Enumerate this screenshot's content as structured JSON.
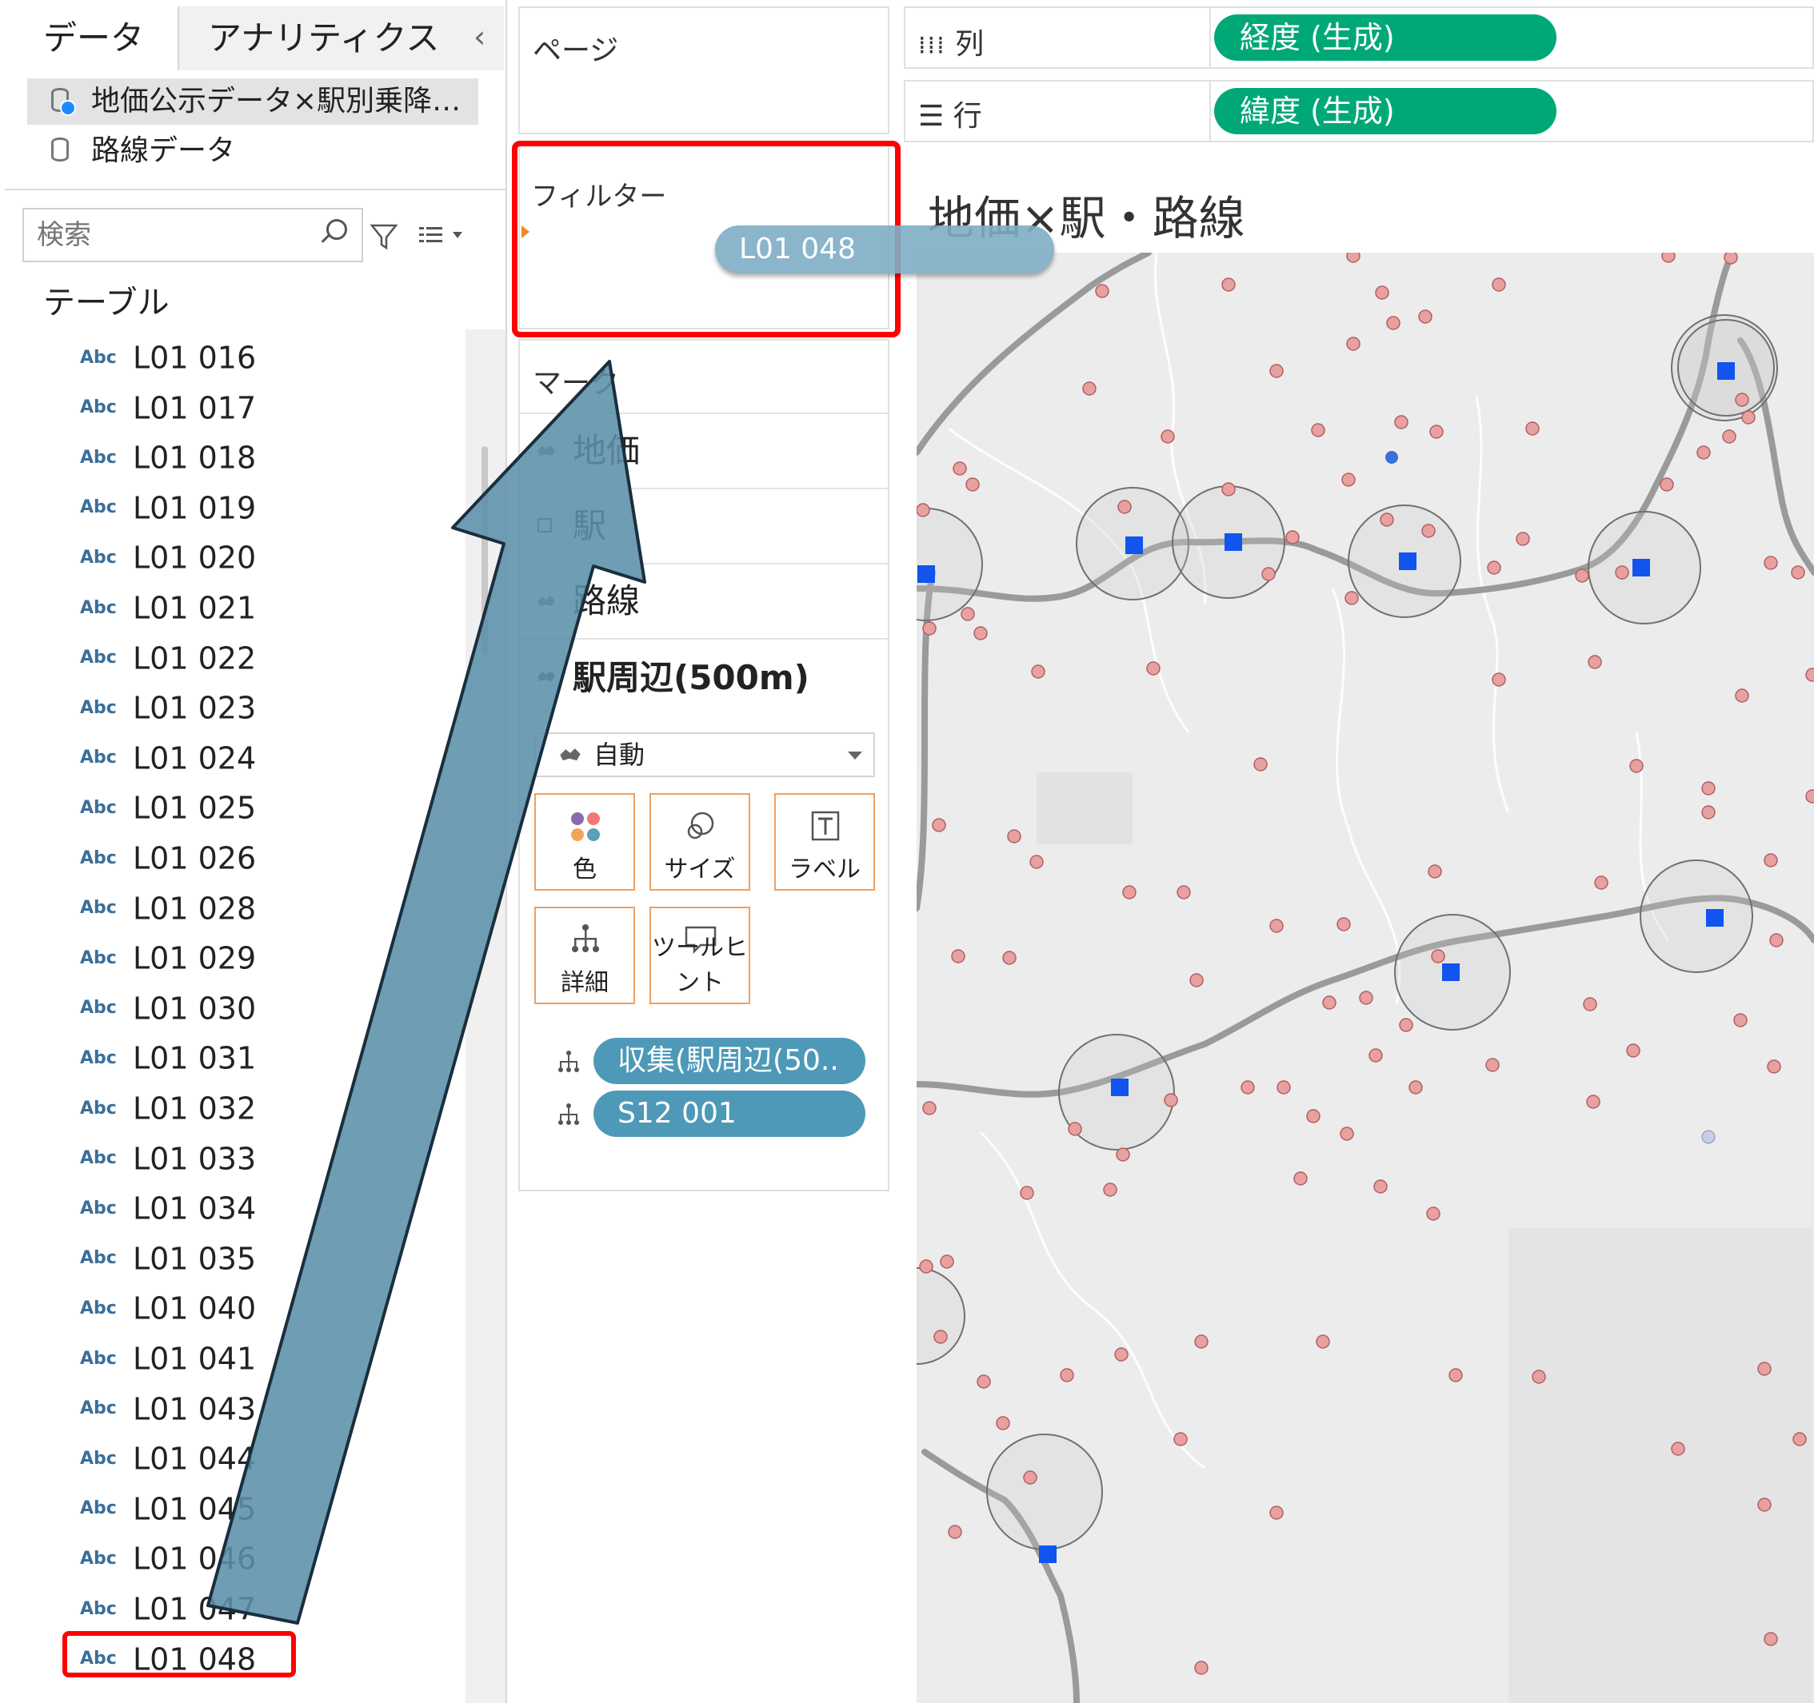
{
  "data_pane": {
    "tabs": [
      "データ",
      "アナリティクス"
    ],
    "datasources": [
      "地価公示データ×駅別乗降…",
      "路線データ"
    ],
    "search_placeholder": "検索",
    "section_title": "テーブル",
    "field_type": "Abc",
    "fields": [
      "L01 016",
      "L01 017",
      "L01 018",
      "L01 019",
      "L01 020",
      "L01 021",
      "L01 022",
      "L01 023",
      "L01 024",
      "L01 025",
      "L01 026",
      "L01 028",
      "L01 029",
      "L01 030",
      "L01 031",
      "L01 032",
      "L01 033",
      "L01 034",
      "L01 035",
      "L01 040",
      "L01 041",
      "L01 043",
      "L01 044",
      "L01 045",
      "L01 046",
      "L01 047",
      "L01 048"
    ]
  },
  "shelves": {
    "pages_label": "ページ",
    "filters_label": "フィルター",
    "filter_pill": "L01 048",
    "marks_label": "マーク",
    "mark_layers": [
      "地価",
      "駅",
      "路線",
      "駅周辺(500m)"
    ],
    "mark_type": "自動",
    "mark_buttons": [
      "色",
      "サイズ",
      "ラベル",
      "詳細",
      "ツールヒント"
    ],
    "detail_pills": [
      "収集(駅周辺(50..",
      "S12 001"
    ],
    "columns_label": "列",
    "columns_pill": "経度 (生成)",
    "rows_label": "行",
    "rows_pill": "緯度 (生成)"
  },
  "view": {
    "title": "地価×駅・路線"
  },
  "colors": {
    "highlight": "#ff0000",
    "green_pill": "#00a878",
    "blue_pill": "#4e99b8",
    "station_mark": "#1155ee",
    "land_price_mark": "#e8a0a0",
    "arrow_fill": "#5b8fa8"
  }
}
